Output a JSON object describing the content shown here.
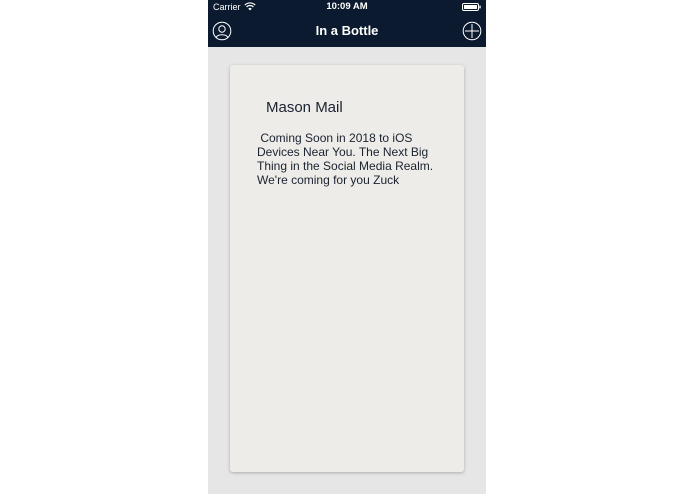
{
  "status_bar": {
    "carrier": "Carrier",
    "time": "10:09 AM"
  },
  "nav": {
    "title": "In a Bottle",
    "left_icon": "profile-icon",
    "right_icon": "add-icon"
  },
  "card": {
    "title": "Mason Mail",
    "body": " Coming Soon in 2018 to iOS Devices Near You. The Next Big Thing in the Social Media Realm. We're coming for you Zuck"
  },
  "colors": {
    "nav_background": "#0b1a2f",
    "screen_background": "#e6e6e6",
    "card_background": "#eeece8",
    "text": "#1a2230"
  }
}
